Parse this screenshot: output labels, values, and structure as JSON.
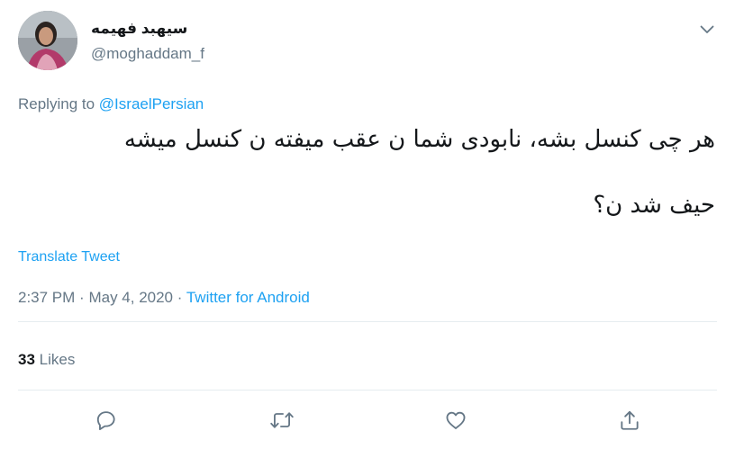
{
  "tweet": {
    "author": {
      "display_name": "سیهبد فهیمه",
      "handle": "@moghaddam_f",
      "avatar_icon": "user-avatar"
    },
    "reply_context": {
      "prefix": "Replying to",
      "mention": "@IsraelPersian"
    },
    "text_lines": [
      "هر چی کنسل بشه، نابودی شما ن عقب میفته ن کنسل میشه",
      "حیف شد ن؟"
    ],
    "translate_label": "Translate Tweet",
    "timestamp": {
      "time": "2:37 PM",
      "separator": "·",
      "date": "May 4, 2020",
      "source": "Twitter for Android"
    },
    "stats": {
      "likes_count": "33",
      "likes_label": "Likes"
    },
    "actions": [
      {
        "name": "reply",
        "icon": "reply-icon"
      },
      {
        "name": "retweet",
        "icon": "retweet-icon"
      },
      {
        "name": "like",
        "icon": "heart-icon"
      },
      {
        "name": "share",
        "icon": "share-icon"
      }
    ]
  },
  "colors": {
    "accent": "#1da1f2",
    "secondary_text": "#657786",
    "primary_text": "#14171a",
    "divider": "#e6ecf0"
  }
}
